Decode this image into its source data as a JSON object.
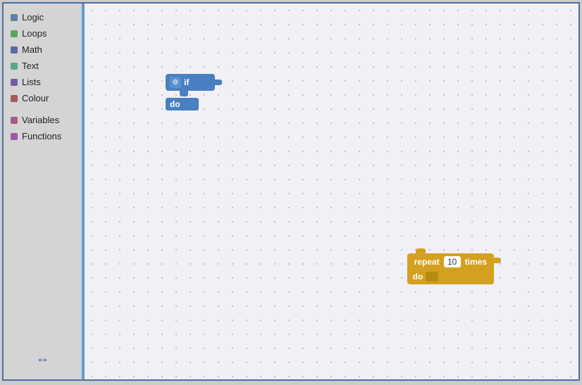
{
  "sidebar": {
    "items": [
      {
        "id": "logic",
        "label": "Logic",
        "color": "#5b80a5"
      },
      {
        "id": "loops",
        "label": "Loops",
        "color": "#5ba55b"
      },
      {
        "id": "math",
        "label": "Math",
        "color": "#5b67a5"
      },
      {
        "id": "text",
        "label": "Text",
        "color": "#5ba58a"
      },
      {
        "id": "lists",
        "label": "Lists",
        "color": "#745ba5"
      },
      {
        "id": "colour",
        "label": "Colour",
        "color": "#a55b5b"
      },
      {
        "id": "variables",
        "label": "Variables",
        "color": "#a55b8a"
      },
      {
        "id": "functions",
        "label": "Functions",
        "color": "#9a5ba5"
      }
    ]
  },
  "blocks": {
    "if_block": {
      "label_if": "if",
      "label_do": "do",
      "gear_icon": "⚙"
    },
    "repeat_block": {
      "label_repeat": "repeat",
      "label_times": "times",
      "label_do": "do",
      "value": "10"
    }
  },
  "resize_icon": "↔"
}
